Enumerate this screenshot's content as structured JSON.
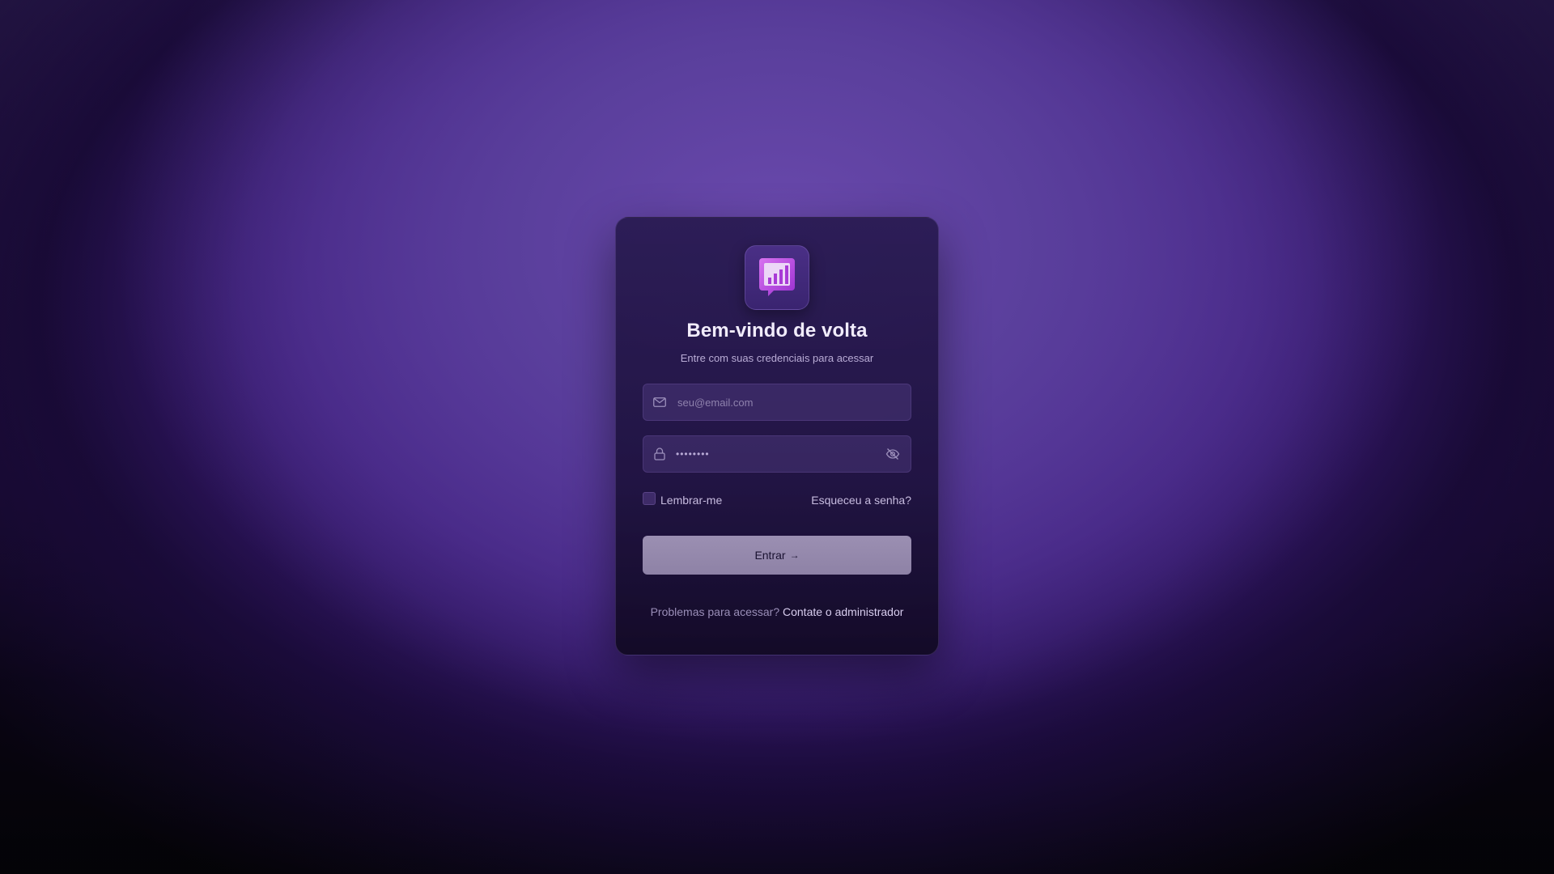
{
  "login": {
    "title": "Bem-vindo de volta",
    "subtitle": "Entre com suas credenciais para acessar",
    "email_field": {
      "placeholder": "seu@email.com",
      "value": "",
      "icon": "mail-icon"
    },
    "password_field": {
      "masked_value": "••••••••",
      "icon": "lock-icon",
      "toggle_icon": "eye-off-icon"
    },
    "remember_label": "Lembrar-me",
    "remember_checked": false,
    "forgot_label": "Esqueceu a senha?",
    "submit_label": "Entrar",
    "submit_arrow": "→",
    "footer_text": "Problemas para acessar?",
    "footer_link": "Contate o administrador"
  },
  "colors": {
    "accent": "#b24ee0",
    "card_bg": "#281a50",
    "button_bg": "#9b8fb2"
  }
}
